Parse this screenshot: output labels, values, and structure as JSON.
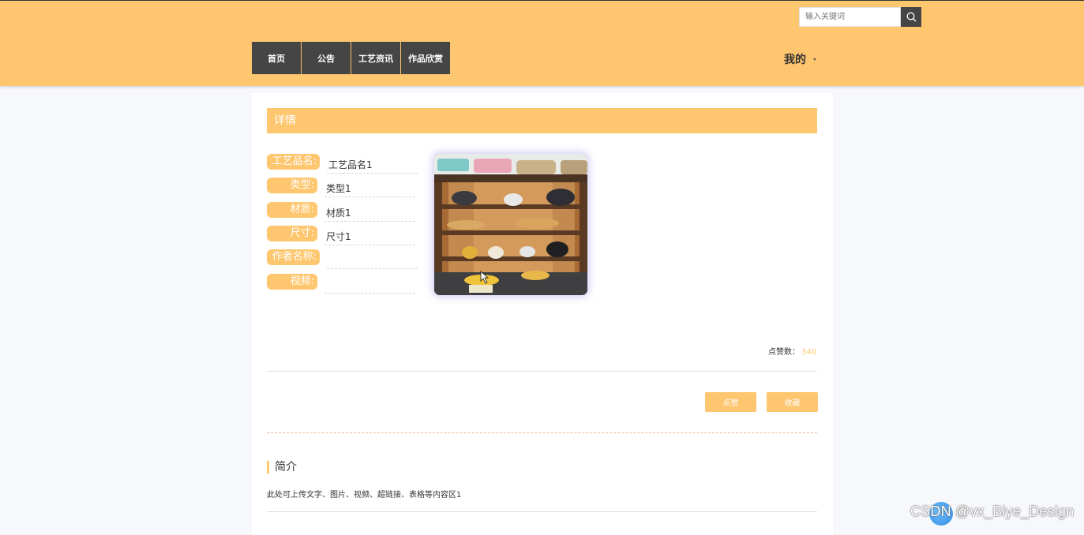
{
  "header": {
    "search": {
      "placeholder": "输入关键词"
    },
    "nav": [
      {
        "label": "首页"
      },
      {
        "label": "公告"
      },
      {
        "label": "工艺资讯"
      },
      {
        "label": "作品欣赏"
      }
    ],
    "user_menu": "我的"
  },
  "detail": {
    "section_title": "详情",
    "fields": [
      {
        "label": "工艺品名:",
        "value": "工艺品名1"
      },
      {
        "label": "类型:",
        "value": "类型1"
      },
      {
        "label": "材质:",
        "value": "材质1"
      },
      {
        "label": "尺寸:",
        "value": "尺寸1"
      },
      {
        "label": "作者名称:",
        "value": ""
      },
      {
        "label": "视频:",
        "value": ""
      }
    ],
    "likes_label": "点赞数：",
    "likes_count": "340",
    "buttons": {
      "like": "点赞",
      "favorite": "收藏"
    }
  },
  "intro": {
    "title": "简介",
    "text": "此处可上传文字、图片、视频、超链接、表格等内容区1"
  },
  "watermark": "CSDN @vx_Biye_Design",
  "colors": {
    "accent": "#fec66e",
    "nav_bg": "#454545"
  }
}
